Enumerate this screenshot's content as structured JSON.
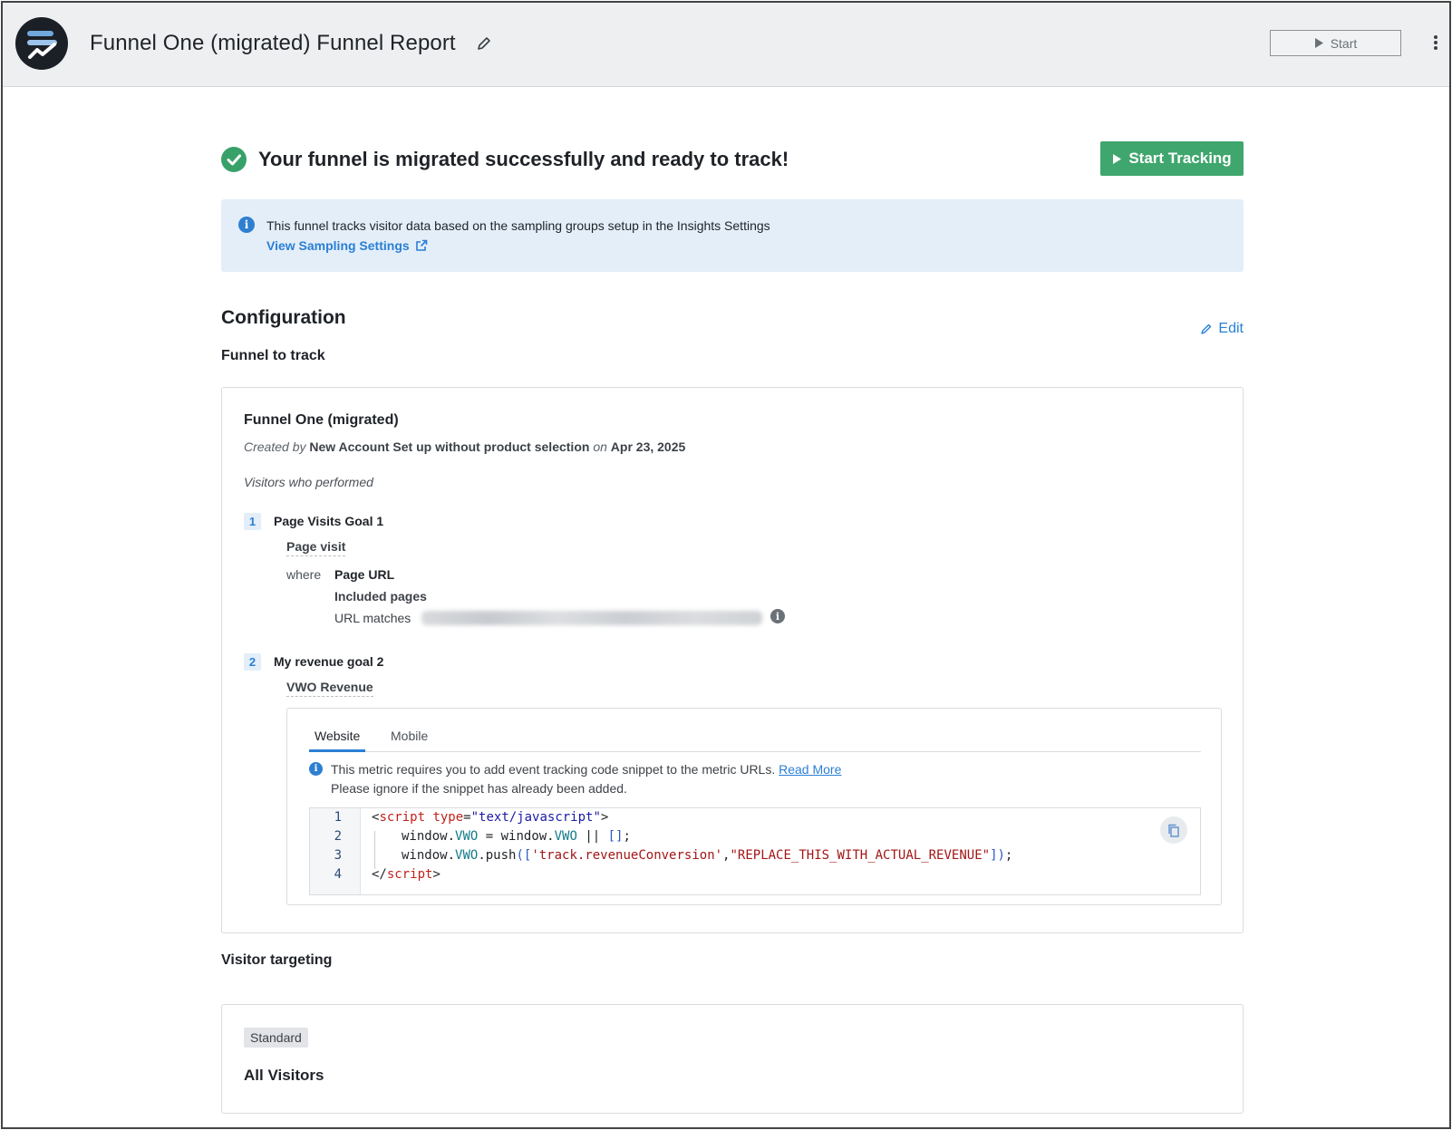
{
  "header": {
    "title": "Funnel One (migrated) Funnel Report",
    "start_label": "Start",
    "icons": {
      "logo": "app-logo",
      "edit": "pencil-icon",
      "more": "kebab-menu-icon",
      "play": "play-icon"
    }
  },
  "status": {
    "message": "Your funnel is migrated successfully and ready to track!",
    "start_tracking_label": "Start Tracking",
    "accent_color": "#3fa66d"
  },
  "banner": {
    "text": "This funnel tracks visitor data based on the sampling groups setup in the Insights Settings",
    "link_label": "View Sampling Settings",
    "background": "#e3eef9"
  },
  "configuration": {
    "title": "Configuration",
    "edit_label": "Edit",
    "funnel_section_label": "Funnel to track",
    "funnel": {
      "name": "Funnel One (migrated)",
      "created_by_prefix": "Created by",
      "creator": "New Account Set up without product selection",
      "on_word": "on",
      "date": "Apr 23, 2025",
      "visitors_performed": "Visitors who performed",
      "steps": [
        {
          "number": "1",
          "name": "Page Visits Goal 1",
          "type": "Page visit",
          "where_word": "where",
          "condition_key": "Page URL",
          "condition_sub": "Included pages",
          "condition_rule": "URL matches"
        },
        {
          "number": "2",
          "name": "My revenue goal 2",
          "type": "VWO Revenue",
          "tabs": [
            "Website",
            "Mobile"
          ],
          "active_tab": "Website",
          "metric_note": "This metric requires you to add event tracking code snippet to the metric URLs.",
          "read_more_label": "Read More",
          "ignore_note": "Please ignore if the snippet has already been added.",
          "code": {
            "line_numbers": [
              "1",
              "2",
              "3",
              "4"
            ],
            "line1": {
              "open": "<",
              "tag": "script",
              "attr": "type",
              "eq": "=",
              "value": "\"text/javascript\"",
              "close": ">"
            },
            "line2": {
              "a": "window.",
              "b": "VWO",
              "c": " = window.",
              "d": "VWO",
              "e": " || ",
              "f": "[]",
              "g": ";"
            },
            "line3": {
              "a": "window.",
              "b": "VWO",
              "c": ".push",
              "d": "([",
              "e": "'track.revenueConversion'",
              "f": ",",
              "g": "\"REPLACE_THIS_WITH_ACTUAL_REVENUE\"",
              "h": "])",
              "i": ";"
            },
            "line4": {
              "open": "</",
              "tag": "script",
              "close": ">"
            }
          }
        }
      ]
    },
    "targeting_label": "Visitor targeting",
    "targeting": {
      "badge": "Standard",
      "audience": "All Visitors"
    }
  }
}
